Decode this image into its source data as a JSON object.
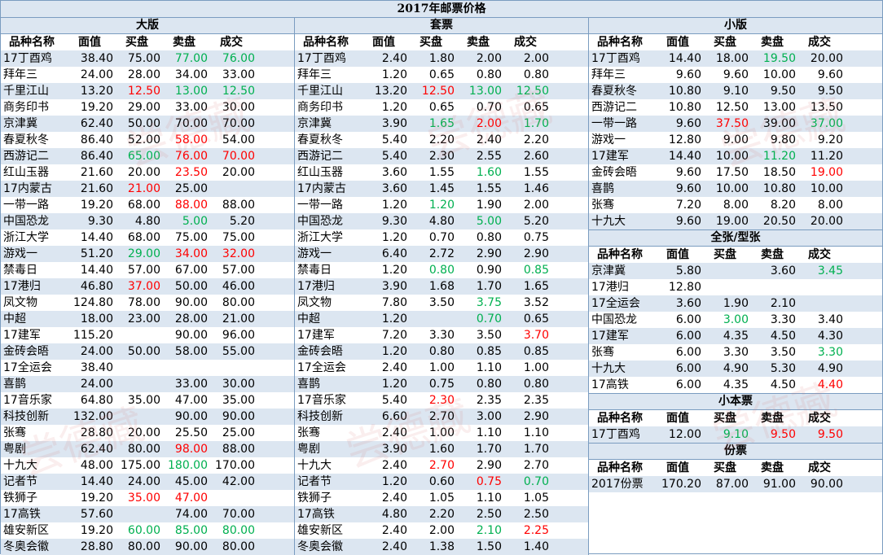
{
  "title": "2017年邮票价格",
  "headers": {
    "name": "品种名称",
    "face": "面值",
    "buy": "买盘",
    "sell": "卖盘",
    "deal": "成交"
  },
  "watermark": "尝德藏",
  "colors": {
    "band": "#dce6f1",
    "border": "#7a9cc0",
    "red": "#ff0000",
    "green": "#00b050"
  },
  "sections": {
    "daban": {
      "title": "大版",
      "rows": [
        {
          "name": "17丁酉鸡",
          "face": "38.40",
          "buy": "75.00",
          "sell": "77.00",
          "deal": "76.00",
          "sc": "grn",
          "dc": "grn"
        },
        {
          "name": "拜年三",
          "face": "24.00",
          "buy": "28.00",
          "sell": "34.00",
          "deal": "33.00"
        },
        {
          "name": "千里江山",
          "face": "13.20",
          "buy": "12.50",
          "sell": "13.00",
          "deal": "12.50",
          "bc": "red",
          "sc": "grn",
          "dc": "grn"
        },
        {
          "name": "商务印书",
          "face": "19.20",
          "buy": "29.00",
          "sell": "33.00",
          "deal": "30.00"
        },
        {
          "name": "京津冀",
          "face": "62.40",
          "buy": "50.00",
          "sell": "70.00",
          "deal": "70.00"
        },
        {
          "name": "春夏秋冬",
          "face": "86.40",
          "buy": "52.00",
          "sell": "58.00",
          "deal": "54.00",
          "sc": "red"
        },
        {
          "name": "西游记二",
          "face": "86.40",
          "buy": "65.00",
          "sell": "76.00",
          "deal": "70.00",
          "bc": "grn",
          "sc": "red",
          "dc": "red"
        },
        {
          "name": "红山玉器",
          "face": "21.60",
          "buy": "20.00",
          "sell": "23.50",
          "deal": "20.00",
          "sc": "red"
        },
        {
          "name": "17内蒙古",
          "face": "21.60",
          "buy": "21.00",
          "sell": "25.00",
          "deal": "",
          "bc": "red"
        },
        {
          "name": "一带一路",
          "face": "19.20",
          "buy": "68.00",
          "sell": "88.00",
          "deal": "88.00",
          "sc": "red"
        },
        {
          "name": "中国恐龙",
          "face": "9.30",
          "buy": "4.80",
          "sell": "5.00",
          "deal": "5.20",
          "sc": "grn"
        },
        {
          "name": "浙江大学",
          "face": "14.40",
          "buy": "68.00",
          "sell": "75.00",
          "deal": "75.00"
        },
        {
          "name": "游戏一",
          "face": "51.20",
          "buy": "29.00",
          "sell": "34.00",
          "deal": "32.00",
          "bc": "grn",
          "sc": "red",
          "dc": "red"
        },
        {
          "name": "禁毒日",
          "face": "14.40",
          "buy": "57.00",
          "sell": "67.00",
          "deal": "57.00"
        },
        {
          "name": "17港归",
          "face": "46.80",
          "buy": "37.00",
          "sell": "50.00",
          "deal": "46.00",
          "bc": "red"
        },
        {
          "name": "凤文物",
          "face": "124.80",
          "buy": "78.00",
          "sell": "90.00",
          "deal": "80.00"
        },
        {
          "name": "中超",
          "face": "18.00",
          "buy": "23.00",
          "sell": "28.00",
          "deal": "21.00"
        },
        {
          "name": "17建军",
          "face": "115.20",
          "buy": "",
          "sell": "90.00",
          "deal": "96.00"
        },
        {
          "name": "金砖会晤",
          "face": "24.00",
          "buy": "50.00",
          "sell": "58.00",
          "deal": "55.00"
        },
        {
          "name": "17全运会",
          "face": "38.40",
          "buy": "",
          "sell": "",
          "deal": ""
        },
        {
          "name": "喜鹊",
          "face": "24.00",
          "buy": "",
          "sell": "33.00",
          "deal": "30.00"
        },
        {
          "name": "17音乐家",
          "face": "64.80",
          "buy": "35.00",
          "sell": "47.00",
          "deal": "35.00"
        },
        {
          "name": "科技创新",
          "face": "132.00",
          "buy": "",
          "sell": "90.00",
          "deal": "90.00"
        },
        {
          "name": "张骞",
          "face": "28.80",
          "buy": "20.00",
          "sell": "25.50",
          "deal": "25.00"
        },
        {
          "name": "粤剧",
          "face": "62.40",
          "buy": "80.00",
          "sell": "98.00",
          "deal": "88.00",
          "sc": "red"
        },
        {
          "name": "十九大",
          "face": "48.00",
          "buy": "175.00",
          "sell": "180.00",
          "deal": "170.00",
          "sc": "grn"
        },
        {
          "name": "记者节",
          "face": "14.40",
          "buy": "24.00",
          "sell": "45.00",
          "deal": "42.00"
        },
        {
          "name": "铁狮子",
          "face": "19.20",
          "buy": "35.00",
          "sell": "47.00",
          "deal": "",
          "bc": "red",
          "sc": "red"
        },
        {
          "name": "17高铁",
          "face": "57.60",
          "buy": "",
          "sell": "74.00",
          "deal": "70.00"
        },
        {
          "name": "雄安新区",
          "face": "19.20",
          "buy": "60.00",
          "sell": "85.00",
          "deal": "80.00",
          "bc": "grn",
          "sc": "grn",
          "dc": "grn"
        },
        {
          "name": "冬奥会徽",
          "face": "28.80",
          "buy": "80.00",
          "sell": "90.00",
          "deal": "80.00"
        }
      ]
    },
    "taopiao": {
      "title": "套票",
      "rows": [
        {
          "name": "17丁酉鸡",
          "face": "2.40",
          "buy": "1.80",
          "sell": "2.00",
          "deal": "2.00"
        },
        {
          "name": "拜年三",
          "face": "1.20",
          "buy": "0.65",
          "sell": "0.80",
          "deal": "0.80"
        },
        {
          "name": "千里江山",
          "face": "13.20",
          "buy": "12.50",
          "sell": "13.00",
          "deal": "12.50",
          "bc": "red",
          "sc": "grn",
          "dc": "grn"
        },
        {
          "name": "商务印书",
          "face": "1.20",
          "buy": "0.65",
          "sell": "0.70",
          "deal": "0.65"
        },
        {
          "name": "京津冀",
          "face": "3.90",
          "buy": "1.65",
          "sell": "2.00",
          "deal": "1.70",
          "bc": "grn",
          "sc": "red",
          "dc": "grn"
        },
        {
          "name": "春夏秋冬",
          "face": "5.40",
          "buy": "2.20",
          "sell": "2.40",
          "deal": "2.20"
        },
        {
          "name": "西游记二",
          "face": "5.40",
          "buy": "2.30",
          "sell": "2.55",
          "deal": "2.60"
        },
        {
          "name": "红山玉器",
          "face": "3.60",
          "buy": "1.55",
          "sell": "1.60",
          "deal": "1.55",
          "sc": "grn"
        },
        {
          "name": "17内蒙古",
          "face": "3.60",
          "buy": "1.45",
          "sell": "1.55",
          "deal": "1.46"
        },
        {
          "name": "一带一路",
          "face": "1.20",
          "buy": "1.20",
          "sell": "1.90",
          "deal": "2.00",
          "bc": "grn"
        },
        {
          "name": "中国恐龙",
          "face": "9.30",
          "buy": "4.80",
          "sell": "5.00",
          "deal": "5.20",
          "sc": "grn"
        },
        {
          "name": "浙江大学",
          "face": "1.20",
          "buy": "0.70",
          "sell": "0.80",
          "deal": "0.75"
        },
        {
          "name": "游戏一",
          "face": "6.40",
          "buy": "2.72",
          "sell": "2.90",
          "deal": "2.90"
        },
        {
          "name": "禁毒日",
          "face": "1.20",
          "buy": "0.80",
          "sell": "0.90",
          "deal": "0.85",
          "bc": "grn",
          "dc": "grn"
        },
        {
          "name": "17港归",
          "face": "3.90",
          "buy": "1.68",
          "sell": "1.70",
          "deal": "1.65"
        },
        {
          "name": "凤文物",
          "face": "7.80",
          "buy": "3.50",
          "sell": "3.75",
          "deal": "3.52",
          "sc": "grn"
        },
        {
          "name": "中超",
          "face": "1.20",
          "buy": "",
          "sell": "0.70",
          "deal": "0.65",
          "sc": "grn"
        },
        {
          "name": "17建军",
          "face": "7.20",
          "buy": "3.30",
          "sell": "3.50",
          "deal": "3.70",
          "dc": "red"
        },
        {
          "name": "金砖会晤",
          "face": "1.20",
          "buy": "0.80",
          "sell": "0.85",
          "deal": "0.85"
        },
        {
          "name": "17全运会",
          "face": "2.40",
          "buy": "1.00",
          "sell": "1.10",
          "deal": "1.00"
        },
        {
          "name": "喜鹊",
          "face": "1.20",
          "buy": "0.75",
          "sell": "0.80",
          "deal": "0.80"
        },
        {
          "name": "17音乐家",
          "face": "5.40",
          "buy": "2.30",
          "sell": "2.35",
          "deal": "2.35",
          "bc": "red"
        },
        {
          "name": "科技创新",
          "face": "6.60",
          "buy": "2.70",
          "sell": "3.00",
          "deal": "2.90"
        },
        {
          "name": "张骞",
          "face": "2.40",
          "buy": "1.00",
          "sell": "1.10",
          "deal": "1.10"
        },
        {
          "name": "粤剧",
          "face": "3.90",
          "buy": "1.60",
          "sell": "1.70",
          "deal": "1.70"
        },
        {
          "name": "十九大",
          "face": "2.40",
          "buy": "2.70",
          "sell": "2.90",
          "deal": "2.70",
          "bc": "red"
        },
        {
          "name": "记者节",
          "face": "1.20",
          "buy": "0.60",
          "sell": "0.75",
          "deal": "0.70",
          "sc": "red",
          "dc": "grn"
        },
        {
          "name": "铁狮子",
          "face": "2.40",
          "buy": "1.05",
          "sell": "1.10",
          "deal": "1.05"
        },
        {
          "name": "17高铁",
          "face": "4.80",
          "buy": "2.20",
          "sell": "2.50",
          "deal": "2.50"
        },
        {
          "name": "雄安新区",
          "face": "2.40",
          "buy": "2.00",
          "sell": "2.10",
          "deal": "2.25",
          "sc": "grn",
          "dc": "red"
        },
        {
          "name": "冬奥会徽",
          "face": "2.40",
          "buy": "1.38",
          "sell": "1.50",
          "deal": "1.40"
        }
      ]
    },
    "xiaoban": {
      "title": "小版",
      "rows": [
        {
          "name": "17丁酉鸡",
          "face": "14.40",
          "buy": "18.00",
          "sell": "19.50",
          "deal": "20.00",
          "sc": "grn"
        },
        {
          "name": "拜年三",
          "face": "9.60",
          "buy": "9.60",
          "sell": "10.00",
          "deal": "9.60"
        },
        {
          "name": "春夏秋冬",
          "face": "10.80",
          "buy": "9.10",
          "sell": "9.50",
          "deal": "9.50"
        },
        {
          "name": "西游记二",
          "face": "10.80",
          "buy": "12.50",
          "sell": "13.00",
          "deal": "13.50"
        },
        {
          "name": "一带一路",
          "face": "9.60",
          "buy": "37.50",
          "sell": "39.00",
          "deal": "37.00",
          "bc": "red",
          "dc": "grn"
        },
        {
          "name": "游戏一",
          "face": "12.80",
          "buy": "9.00",
          "sell": "9.80",
          "deal": "9.20"
        },
        {
          "name": "17建军",
          "face": "14.40",
          "buy": "10.00",
          "sell": "11.20",
          "deal": "11.20",
          "sc": "grn"
        },
        {
          "name": "金砖会晤",
          "face": "9.60",
          "buy": "17.50",
          "sell": "18.50",
          "deal": "19.00",
          "dc": "red"
        },
        {
          "name": "喜鹊",
          "face": "9.60",
          "buy": "10.00",
          "sell": "10.80",
          "deal": "10.00"
        },
        {
          "name": "张骞",
          "face": "7.20",
          "buy": "8.00",
          "sell": "8.20",
          "deal": "8.00"
        },
        {
          "name": "十九大",
          "face": "9.60",
          "buy": "19.00",
          "sell": "20.50",
          "deal": "20.00"
        }
      ]
    },
    "quanzhang": {
      "title": "全张/型张",
      "rows": [
        {
          "name": "京津冀",
          "face": "5.80",
          "buy": "",
          "sell": "3.60",
          "deal": "3.45",
          "dc": "grn"
        },
        {
          "name": "17港归",
          "face": "12.80",
          "buy": "",
          "sell": "",
          "deal": ""
        },
        {
          "name": "17全运会",
          "face": "3.60",
          "buy": "1.90",
          "sell": "2.10",
          "deal": ""
        },
        {
          "name": "中国恐龙",
          "face": "6.00",
          "buy": "3.00",
          "sell": "3.30",
          "deal": "3.40",
          "bc": "grn"
        },
        {
          "name": "17建军",
          "face": "6.00",
          "buy": "4.35",
          "sell": "4.50",
          "deal": "4.30"
        },
        {
          "name": "张骞",
          "face": "6.00",
          "buy": "3.30",
          "sell": "3.50",
          "deal": "3.30",
          "dc": "grn"
        },
        {
          "name": "十九大",
          "face": "6.00",
          "buy": "4.90",
          "sell": "5.30",
          "deal": "4.90"
        },
        {
          "name": "17高铁",
          "face": "6.00",
          "buy": "4.35",
          "sell": "4.50",
          "deal": "4.40",
          "dc": "red"
        }
      ]
    },
    "xiaobenpiao": {
      "title": "小本票",
      "rows": [
        {
          "name": "17丁酉鸡",
          "face": "12.00",
          "buy": "9.10",
          "sell": "9.50",
          "deal": "9.50",
          "bc": "grn",
          "sc": "red",
          "dc": "red"
        }
      ]
    },
    "fenpiao": {
      "title": "份票",
      "rows": [
        {
          "name": "2017份票",
          "face": "170.20",
          "buy": "87.00",
          "sell": "91.00",
          "deal": "90.00"
        }
      ]
    }
  }
}
